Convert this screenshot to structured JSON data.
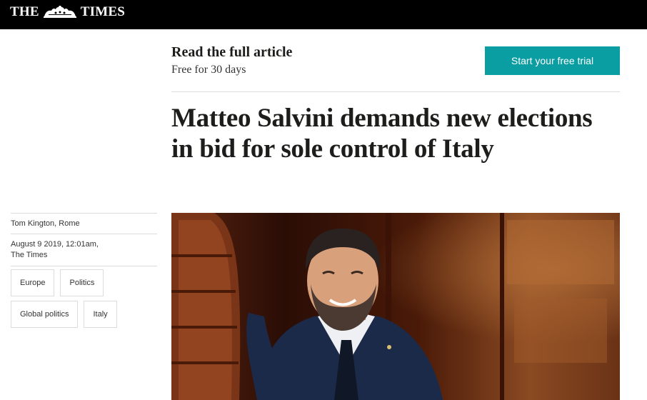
{
  "masthead": {
    "logo_left": "THE",
    "logo_right": "TIMES"
  },
  "promo": {
    "title": "Read the full article",
    "subtitle": "Free for 30 days",
    "cta_label": "Start your free trial"
  },
  "article": {
    "headline": "Matteo Salvini demands new elections in bid for sole control of Italy",
    "byline": "Tom Kington, Rome",
    "date_line1": "August 9 2019, 12:01am,",
    "date_line2": "The Times",
    "tags": [
      "Europe",
      "Politics",
      "Global politics",
      "Italy"
    ]
  },
  "colors": {
    "masthead": "#000000",
    "cta": "#0a9ea3",
    "rule": "#dcdcdc"
  }
}
